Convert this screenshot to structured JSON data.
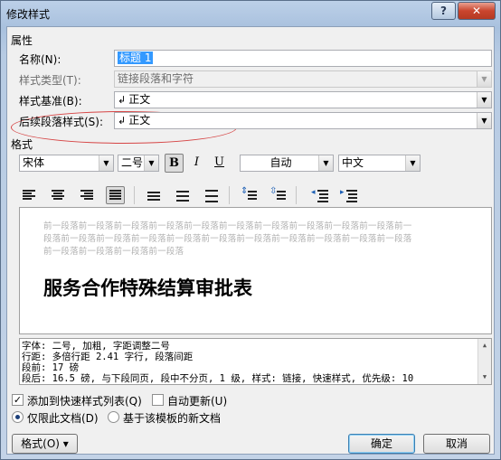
{
  "window": {
    "title": "修改样式",
    "help_label": "?",
    "close_label": "✕"
  },
  "properties": {
    "section_label": "属性",
    "name_label": "名称(N):",
    "name_value": "标题 1",
    "type_label": "样式类型(T):",
    "type_value": "链接段落和字符",
    "based_on_label": "样式基准(B):",
    "based_on_value": "正文",
    "following_label": "后续段落样式(S):",
    "following_value": "正文",
    "para_icon": "↲",
    "annotation_color": "#d64545"
  },
  "format": {
    "section_label": "格式",
    "font_name": "宋体",
    "font_size": "二号",
    "bold": "B",
    "italic": "I",
    "underline": "U",
    "color": "自动",
    "script": "中文"
  },
  "preview": {
    "ghost_lines": [
      "前一段落前一段落前一段落前一段落前一段落前一段落前一段落前一段落前一段落前一段落前一",
      "段落前一段落前一段落前一段落前一段落前一段落前一段落前一段落前一段落前一段落前一段落",
      "前一段落前一段落前一段落前一段落"
    ],
    "sample_text": "服务合作特殊结算审批表"
  },
  "description": {
    "lines": [
      "字体: 二号, 加粗, 字距调整二号",
      "    行距: 多倍行距 2.41 字行, 段落间距",
      "    段前: 17 磅",
      "    段后: 16.5 磅, 与下段同页, 段中不分页, 1 级, 样式: 链接, 快速样式, 优先级: 10"
    ]
  },
  "options": {
    "add_to_quick_label": "添加到快速样式列表(Q)",
    "auto_update_label": "自动更新(U)",
    "only_this_doc_label": "仅限此文档(D)",
    "new_docs_label": "基于该模板的新文档",
    "check_mark": "✓"
  },
  "buttons": {
    "format_label": "格式(O) ▾",
    "ok_label": "确定",
    "cancel_label": "取消"
  }
}
